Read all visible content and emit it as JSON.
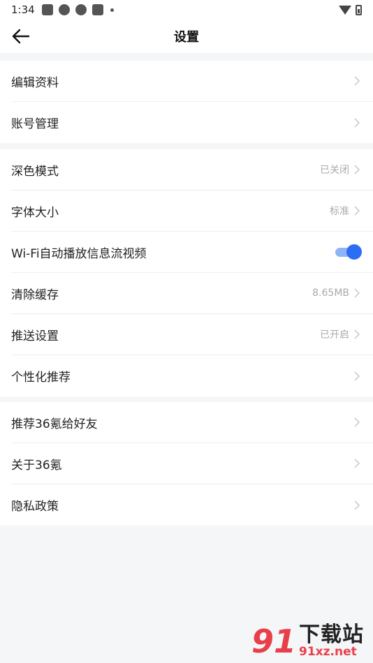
{
  "status_bar": {
    "time": "1:34"
  },
  "header": {
    "title": "设置",
    "back_icon": "arrow-left-icon"
  },
  "groups": [
    {
      "items": [
        {
          "label": "编辑资料",
          "value": "",
          "control": "chevron"
        },
        {
          "label": "账号管理",
          "value": "",
          "control": "chevron"
        }
      ]
    },
    {
      "items": [
        {
          "label": "深色模式",
          "value": "已关闭",
          "control": "chevron"
        },
        {
          "label": "字体大小",
          "value": "标准",
          "control": "chevron"
        },
        {
          "label": "Wi-Fi自动播放信息流视频",
          "value": "",
          "control": "toggle",
          "toggle_on": true
        },
        {
          "label": "清除缓存",
          "value": "8.65MB",
          "control": "chevron"
        },
        {
          "label": "推送设置",
          "value": "已开启",
          "control": "chevron"
        },
        {
          "label": "个性化推荐",
          "value": "",
          "control": "chevron"
        }
      ]
    },
    {
      "items": [
        {
          "label": "推荐36氪给好友",
          "value": "",
          "control": "chevron"
        },
        {
          "label": "关于36氪",
          "value": "",
          "control": "chevron"
        },
        {
          "label": "隐私政策",
          "value": "",
          "control": "chevron"
        }
      ]
    }
  ],
  "watermark": {
    "logo": "91",
    "name": "下载站",
    "url": "91xz.net"
  },
  "colors": {
    "accent": "#2b6ef5",
    "background": "#f5f6f8",
    "watermark_red": "#e8404a"
  }
}
